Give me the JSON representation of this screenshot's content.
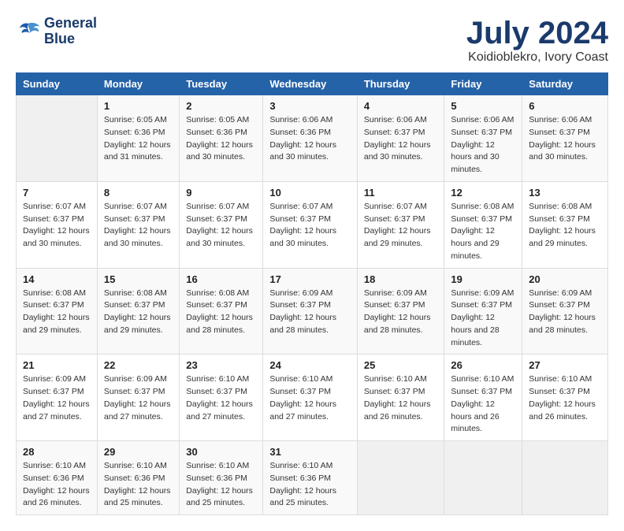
{
  "logo": {
    "line1": "General",
    "line2": "Blue"
  },
  "title": "July 2024",
  "subtitle": "Koidioblekro, Ivory Coast",
  "header": {
    "days": [
      "Sunday",
      "Monday",
      "Tuesday",
      "Wednesday",
      "Thursday",
      "Friday",
      "Saturday"
    ]
  },
  "weeks": [
    [
      {
        "day": "",
        "info": ""
      },
      {
        "day": "1",
        "sunrise": "6:05 AM",
        "sunset": "6:36 PM",
        "daylight": "12 hours and 31 minutes."
      },
      {
        "day": "2",
        "sunrise": "6:05 AM",
        "sunset": "6:36 PM",
        "daylight": "12 hours and 30 minutes."
      },
      {
        "day": "3",
        "sunrise": "6:06 AM",
        "sunset": "6:36 PM",
        "daylight": "12 hours and 30 minutes."
      },
      {
        "day": "4",
        "sunrise": "6:06 AM",
        "sunset": "6:37 PM",
        "daylight": "12 hours and 30 minutes."
      },
      {
        "day": "5",
        "sunrise": "6:06 AM",
        "sunset": "6:37 PM",
        "daylight": "12 hours and 30 minutes."
      },
      {
        "day": "6",
        "sunrise": "6:06 AM",
        "sunset": "6:37 PM",
        "daylight": "12 hours and 30 minutes."
      }
    ],
    [
      {
        "day": "7",
        "sunrise": "6:07 AM",
        "sunset": "6:37 PM",
        "daylight": "12 hours and 30 minutes."
      },
      {
        "day": "8",
        "sunrise": "6:07 AM",
        "sunset": "6:37 PM",
        "daylight": "12 hours and 30 minutes."
      },
      {
        "day": "9",
        "sunrise": "6:07 AM",
        "sunset": "6:37 PM",
        "daylight": "12 hours and 30 minutes."
      },
      {
        "day": "10",
        "sunrise": "6:07 AM",
        "sunset": "6:37 PM",
        "daylight": "12 hours and 30 minutes."
      },
      {
        "day": "11",
        "sunrise": "6:07 AM",
        "sunset": "6:37 PM",
        "daylight": "12 hours and 29 minutes."
      },
      {
        "day": "12",
        "sunrise": "6:08 AM",
        "sunset": "6:37 PM",
        "daylight": "12 hours and 29 minutes."
      },
      {
        "day": "13",
        "sunrise": "6:08 AM",
        "sunset": "6:37 PM",
        "daylight": "12 hours and 29 minutes."
      }
    ],
    [
      {
        "day": "14",
        "sunrise": "6:08 AM",
        "sunset": "6:37 PM",
        "daylight": "12 hours and 29 minutes."
      },
      {
        "day": "15",
        "sunrise": "6:08 AM",
        "sunset": "6:37 PM",
        "daylight": "12 hours and 29 minutes."
      },
      {
        "day": "16",
        "sunrise": "6:08 AM",
        "sunset": "6:37 PM",
        "daylight": "12 hours and 28 minutes."
      },
      {
        "day": "17",
        "sunrise": "6:09 AM",
        "sunset": "6:37 PM",
        "daylight": "12 hours and 28 minutes."
      },
      {
        "day": "18",
        "sunrise": "6:09 AM",
        "sunset": "6:37 PM",
        "daylight": "12 hours and 28 minutes."
      },
      {
        "day": "19",
        "sunrise": "6:09 AM",
        "sunset": "6:37 PM",
        "daylight": "12 hours and 28 minutes."
      },
      {
        "day": "20",
        "sunrise": "6:09 AM",
        "sunset": "6:37 PM",
        "daylight": "12 hours and 28 minutes."
      }
    ],
    [
      {
        "day": "21",
        "sunrise": "6:09 AM",
        "sunset": "6:37 PM",
        "daylight": "12 hours and 27 minutes."
      },
      {
        "day": "22",
        "sunrise": "6:09 AM",
        "sunset": "6:37 PM",
        "daylight": "12 hours and 27 minutes."
      },
      {
        "day": "23",
        "sunrise": "6:10 AM",
        "sunset": "6:37 PM",
        "daylight": "12 hours and 27 minutes."
      },
      {
        "day": "24",
        "sunrise": "6:10 AM",
        "sunset": "6:37 PM",
        "daylight": "12 hours and 27 minutes."
      },
      {
        "day": "25",
        "sunrise": "6:10 AM",
        "sunset": "6:37 PM",
        "daylight": "12 hours and 26 minutes."
      },
      {
        "day": "26",
        "sunrise": "6:10 AM",
        "sunset": "6:37 PM",
        "daylight": "12 hours and 26 minutes."
      },
      {
        "day": "27",
        "sunrise": "6:10 AM",
        "sunset": "6:37 PM",
        "daylight": "12 hours and 26 minutes."
      }
    ],
    [
      {
        "day": "28",
        "sunrise": "6:10 AM",
        "sunset": "6:36 PM",
        "daylight": "12 hours and 26 minutes."
      },
      {
        "day": "29",
        "sunrise": "6:10 AM",
        "sunset": "6:36 PM",
        "daylight": "12 hours and 25 minutes."
      },
      {
        "day": "30",
        "sunrise": "6:10 AM",
        "sunset": "6:36 PM",
        "daylight": "12 hours and 25 minutes."
      },
      {
        "day": "31",
        "sunrise": "6:10 AM",
        "sunset": "6:36 PM",
        "daylight": "12 hours and 25 minutes."
      },
      {
        "day": "",
        "info": ""
      },
      {
        "day": "",
        "info": ""
      },
      {
        "day": "",
        "info": ""
      }
    ]
  ]
}
